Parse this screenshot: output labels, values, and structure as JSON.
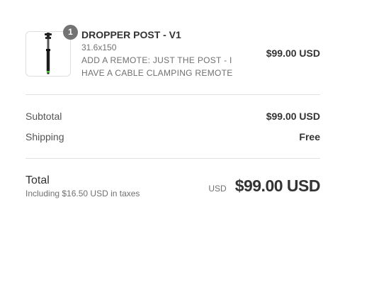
{
  "line_item": {
    "quantity": "1",
    "title": "DROPPER POST - V1",
    "variant": "31.6x150",
    "option_line1": "ADD A REMOTE: JUST THE POST - I",
    "option_line2": "HAVE A CABLE CLAMPING REMOTE",
    "price": "$99.00 USD",
    "image_icon": "dropper-post-product-image"
  },
  "costs": {
    "subtotal_label": "Subtotal",
    "subtotal_value": "$99.00 USD",
    "shipping_label": "Shipping",
    "shipping_value": "Free"
  },
  "total": {
    "label": "Total",
    "tax_note": "Including $16.50 USD in taxes",
    "currency": "USD",
    "amount": "$99.00 USD"
  },
  "colors": {
    "badge": "#737373",
    "accent_green": "#4fc43a",
    "divider": "#e1e1e1"
  }
}
